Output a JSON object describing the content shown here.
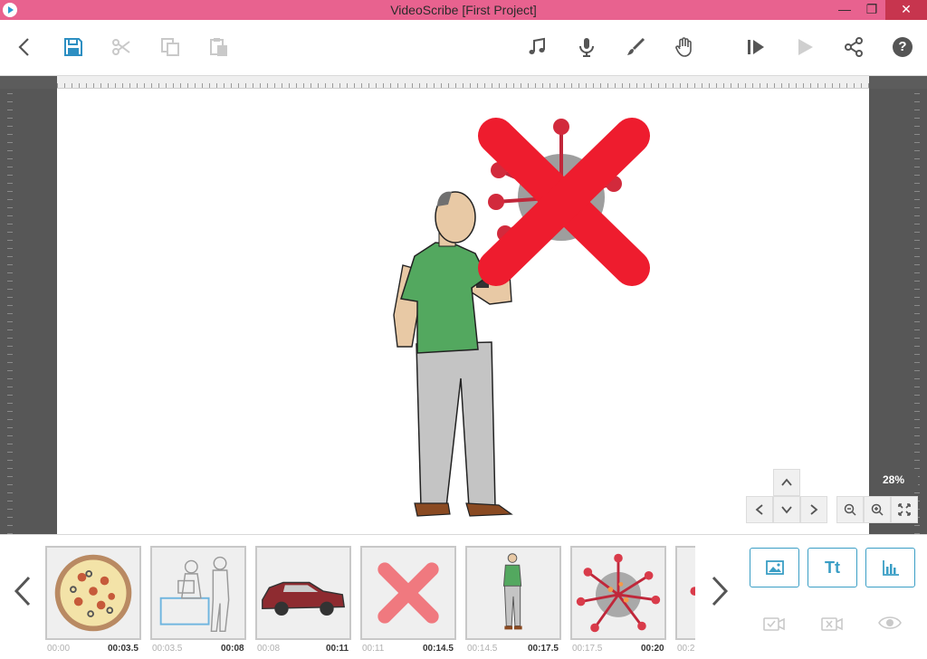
{
  "window": {
    "title": "VideoScribe [First Project]",
    "minimize": "—",
    "restore": "❐",
    "close": "✕"
  },
  "toolbar": {
    "left": [
      "back-icon",
      "save-icon",
      "cut-icon",
      "copy-icon",
      "paste-icon"
    ],
    "right": [
      "music-icon",
      "microphone-icon",
      "brush-icon",
      "hand-icon",
      "play-from-icon",
      "play-icon",
      "share-icon",
      "help-icon"
    ],
    "help_label": "?"
  },
  "canvas": {
    "zoom": "28%"
  },
  "timeline": {
    "thumbnails": [
      {
        "name": "pizza",
        "start": "00:00",
        "end": "00:03.5"
      },
      {
        "name": "office-workers",
        "start": "00:03.5",
        "end": "00:08"
      },
      {
        "name": "car",
        "start": "00:08",
        "end": "00:11"
      },
      {
        "name": "red-cross",
        "start": "00:11",
        "end": "00:14.5"
      },
      {
        "name": "man-checking-watch",
        "start": "00:14.5",
        "end": "00:17.5"
      },
      {
        "name": "virus",
        "start": "00:17.5",
        "end": "00:20"
      },
      {
        "name": "partial",
        "start": "00:2",
        "end": ""
      }
    ],
    "add_text_label": "Tt"
  },
  "colors": {
    "titlebar": "#e8628f",
    "accent": "#3a9ec5",
    "cross_red": "#ee1c2e",
    "shirt_green": "#53a85f"
  }
}
